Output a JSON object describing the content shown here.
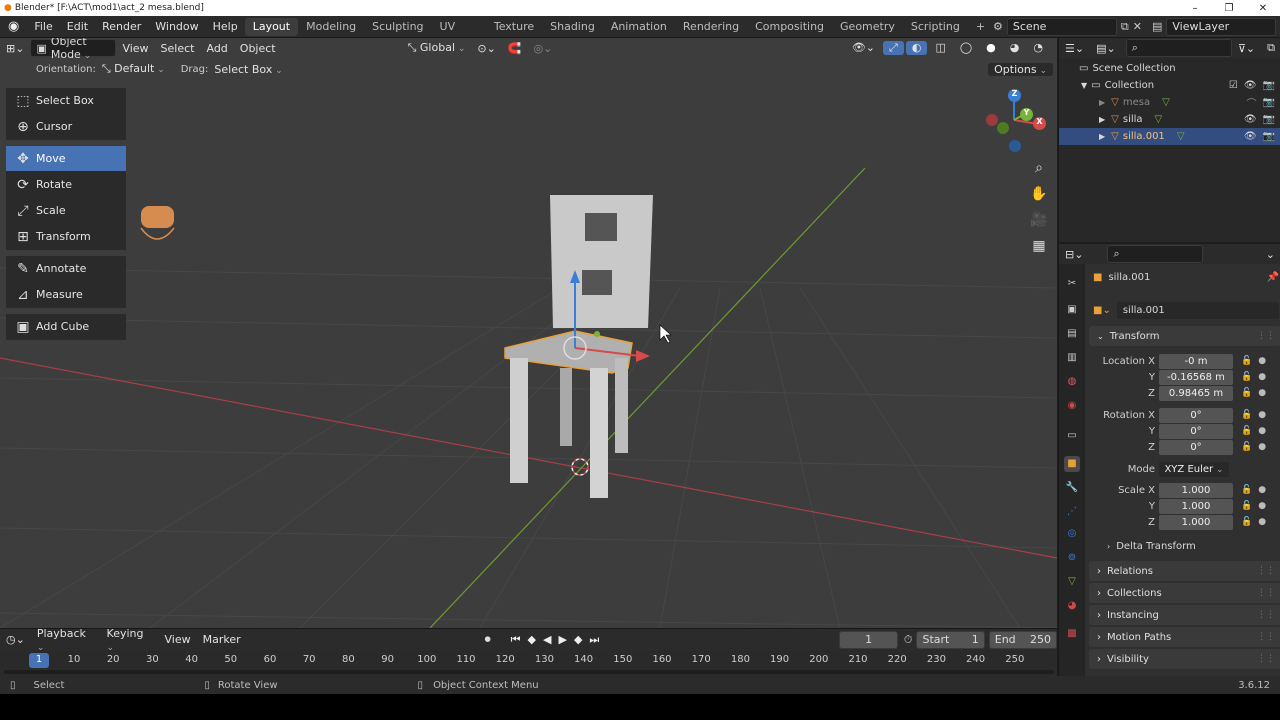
{
  "titlebar": {
    "text": "Blender* [F:\\ACT\\mod1\\act_2 mesa.blend]",
    "minimize": "–",
    "maximize": "❐",
    "close": "✕"
  },
  "menu": [
    "File",
    "Edit",
    "Render",
    "Window",
    "Help"
  ],
  "workspaces": [
    "Layout",
    "Modeling",
    "Sculpting",
    "UV Editing",
    "Texture Paint",
    "Shading",
    "Animation",
    "Rendering",
    "Compositing",
    "Geometry Nodes",
    "Scripting"
  ],
  "add_workspace": "+",
  "scene": "Scene",
  "view_layer": "ViewLayer",
  "viewport": {
    "mode": "Object Mode",
    "menus": [
      "View",
      "Select",
      "Add",
      "Object"
    ],
    "transform_orientation": "Global",
    "orientation_label": "Orientation:",
    "orientation_value": "Default",
    "drag_label": "Drag:",
    "drag_value": "Select Box",
    "options": "Options"
  },
  "tools": [
    {
      "label": "Select Box",
      "icon": "select-box-icon",
      "glyph": "⬚"
    },
    {
      "label": "Cursor",
      "icon": "cursor-icon",
      "glyph": "⊕"
    },
    {
      "label": "Move",
      "icon": "move-icon",
      "glyph": "✥"
    },
    {
      "label": "Rotate",
      "icon": "rotate-icon",
      "glyph": "⟳"
    },
    {
      "label": "Scale",
      "icon": "scale-icon",
      "glyph": "⤢"
    },
    {
      "label": "Transform",
      "icon": "transform-icon",
      "glyph": "⊞"
    },
    {
      "label": "Annotate",
      "icon": "annotate-icon",
      "glyph": "✎"
    },
    {
      "label": "Measure",
      "icon": "measure-icon",
      "glyph": "📐"
    },
    {
      "label": "Add Cube",
      "icon": "add-cube-icon",
      "glyph": "▣"
    }
  ],
  "gizmo": {
    "z": "Z",
    "y": "Y",
    "x": "X"
  },
  "timeline": {
    "menus": [
      "Playback",
      "Keying",
      "View",
      "Marker"
    ],
    "current_frame": "1",
    "start_label": "Start",
    "start": "1",
    "end_label": "End",
    "end": "250",
    "ruler": [
      "1",
      "10",
      "20",
      "30",
      "40",
      "50",
      "60",
      "70",
      "80",
      "90",
      "100",
      "110",
      "120",
      "130",
      "140",
      "150",
      "160",
      "170",
      "180",
      "190",
      "200",
      "210",
      "220",
      "230",
      "240",
      "250"
    ]
  },
  "status": {
    "select": "Select",
    "rotate": "Rotate View",
    "context": "Object Context Menu",
    "version": "3.6.12"
  },
  "outliner": {
    "scene_collection": "Scene Collection",
    "collection": "Collection",
    "items": [
      "mesa",
      "silla",
      "silla.001"
    ]
  },
  "properties": {
    "object_name": "silla.001",
    "data_name": "silla.001",
    "transform_header": "Transform",
    "location_label": "Location X",
    "location": [
      "-0 m",
      "-0.16568 m",
      "0.98465 m"
    ],
    "rotation_label": "Rotation X",
    "rotation": [
      "0°",
      "0°",
      "0°"
    ],
    "mode_label": "Mode",
    "mode_value": "XYZ Euler",
    "scale_label": "Scale X",
    "scale": [
      "1.000",
      "1.000",
      "1.000"
    ],
    "axis_y": "Y",
    "axis_z": "Z",
    "delta": "Delta Transform",
    "panels": [
      "Relations",
      "Collections",
      "Instancing",
      "Motion Paths",
      "Visibility"
    ]
  },
  "colors": {
    "accent": "#4772b3",
    "selection": "#e8a03a",
    "x_axis": "#d64a4a",
    "y_axis": "#7ab33a",
    "z_axis": "#3a7fd6"
  }
}
